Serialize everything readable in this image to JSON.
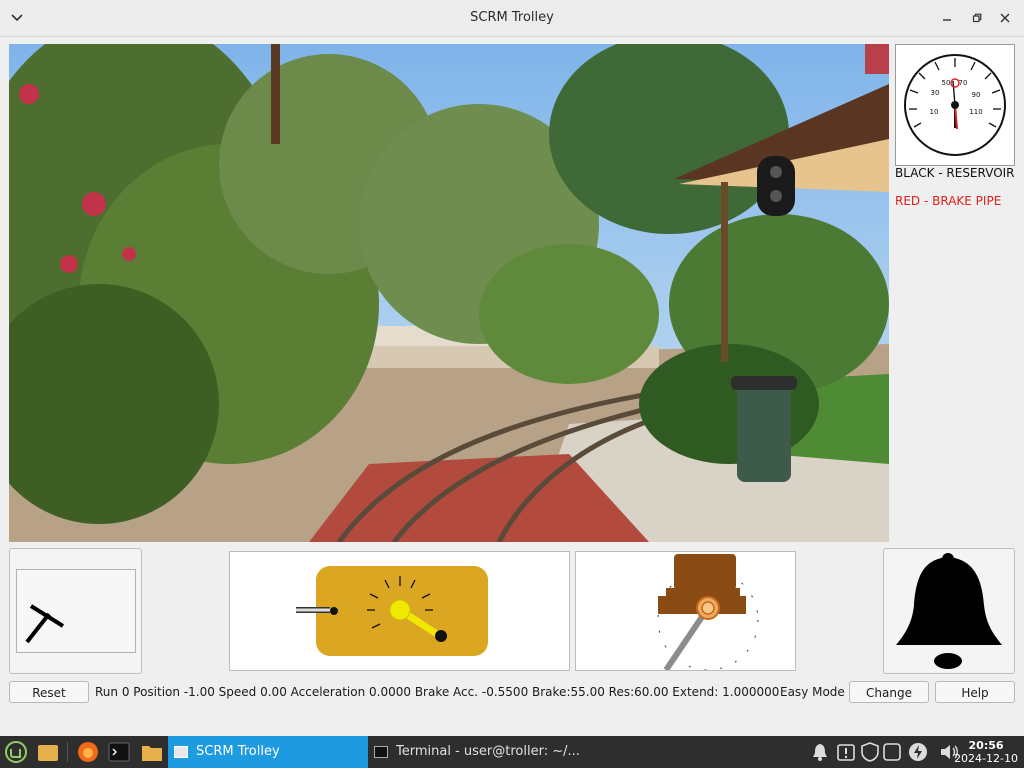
{
  "window": {
    "title": "SCRM Trolley"
  },
  "gauge": {
    "scale_labels": [
      "30",
      "50",
      "70",
      "90",
      "10",
      "110"
    ],
    "legend_black": "BLACK - RESERVOIR",
    "legend_red": "RED - BRAKE PIPE",
    "reservoir_psi": 60,
    "brake_pipe_psi": 55
  },
  "controls": {
    "reset_label": "Reset",
    "status": "Run 0 Position -1.00 Speed 0.00 Acceleration 0.0000 Brake Acc. -0.5500 Brake:55.00 Res:60.00 Extend: 1.000000",
    "mode_label": "Easy Mode",
    "change_label": "Change",
    "help_label": "Help"
  },
  "taskbar": {
    "tasks": [
      {
        "label": "SCRM Trolley",
        "active": true
      },
      {
        "label": "Terminal - user@troller: ~/...",
        "active": false
      }
    ],
    "clock_time": "20:56",
    "clock_date": "2024-12-10"
  },
  "colors": {
    "controller_plate": "#dba621",
    "brake_housing": "#8a4a14",
    "taskbar_active": "#1d9ae0",
    "red_legend": "#e0201a"
  }
}
